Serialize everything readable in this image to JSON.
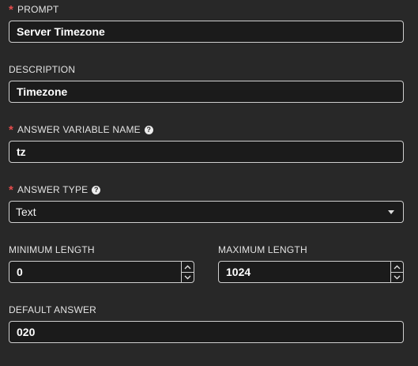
{
  "form": {
    "prompt": {
      "label": "PROMPT",
      "required": true,
      "value": "Server Timezone"
    },
    "description": {
      "label": "DESCRIPTION",
      "required": false,
      "value": "Timezone"
    },
    "answer_variable_name": {
      "label": "ANSWER VARIABLE NAME",
      "required": true,
      "has_help": true,
      "value": "tz"
    },
    "answer_type": {
      "label": "ANSWER TYPE",
      "required": true,
      "has_help": true,
      "selected": "Text"
    },
    "minimum_length": {
      "label": "MINIMUM LENGTH",
      "value": "0"
    },
    "maximum_length": {
      "label": "MAXIMUM LENGTH",
      "value": "1024"
    },
    "default_answer": {
      "label": "DEFAULT ANSWER",
      "value": "020"
    }
  },
  "symbols": {
    "required_marker": "*",
    "help_glyph": "?"
  },
  "colors": {
    "background": "#282828",
    "input_background": "#1b1b1b",
    "input_border": "#cfcfcf",
    "required_marker": "#e34c4c",
    "label_text": "#e3e3e3",
    "value_text": "#ffffff"
  },
  "icons": {
    "help": "question-circle-icon",
    "dropdown": "caret-down-icon",
    "spin_up": "chevron-up-icon",
    "spin_down": "chevron-down-icon"
  }
}
